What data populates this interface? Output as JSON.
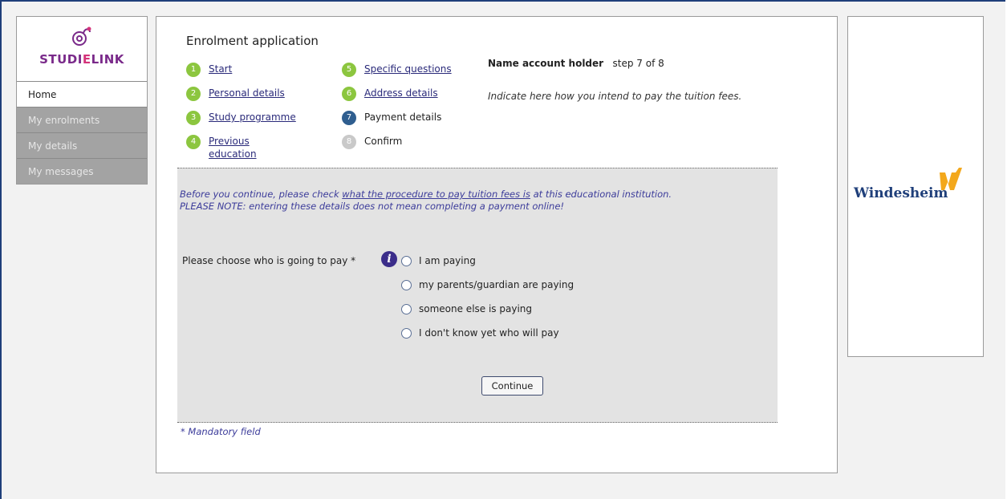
{
  "sidebar": {
    "logo": {
      "prefix": "STUDI",
      "highlight": "E",
      "suffix": "LINK"
    },
    "items": [
      {
        "label": "Home",
        "active": true
      },
      {
        "label": "My enrolments",
        "active": false
      },
      {
        "label": "My details",
        "active": false
      },
      {
        "label": "My messages",
        "active": false
      }
    ]
  },
  "main": {
    "title": "Enrolment application",
    "steps": [
      {
        "num": "1",
        "label": "Start",
        "state": "done"
      },
      {
        "num": "2",
        "label": "Personal details",
        "state": "done"
      },
      {
        "num": "3",
        "label": "Study programme",
        "state": "done"
      },
      {
        "num": "4",
        "label": "Previous education",
        "state": "done"
      },
      {
        "num": "5",
        "label": "Specific questions",
        "state": "done"
      },
      {
        "num": "6",
        "label": "Address details",
        "state": "done"
      },
      {
        "num": "7",
        "label": "Payment details",
        "state": "current"
      },
      {
        "num": "8",
        "label": "Confirm",
        "state": "future"
      }
    ],
    "step4_line1": "Previous",
    "step4_line2": "education",
    "account": {
      "title": "Name account holder",
      "step_text": "step 7 of 8",
      "description": "Indicate here how you intend to pay the tuition fees."
    },
    "notice": {
      "before": "Before you continue, please check ",
      "link": "what the procedure to pay tuition fees is",
      "after": " at this educational institution.",
      "line2": "PLEASE NOTE: entering these details does not mean completing a payment online!"
    },
    "question_label": "Please choose who is going to pay *",
    "options": [
      "I am paying",
      "my parents/guardian are paying",
      "someone else is paying",
      "I don't know yet who will pay"
    ],
    "continue_label": "Continue",
    "mandatory_note": "* Mandatory field"
  },
  "banner": {
    "name": "Windesheim"
  },
  "colors": {
    "step_done": "#8cc63f",
    "step_current": "#2f5e8f",
    "step_future": "#c9c9c9",
    "link": "#2a2a7a",
    "frame": "#1f3f7a"
  }
}
